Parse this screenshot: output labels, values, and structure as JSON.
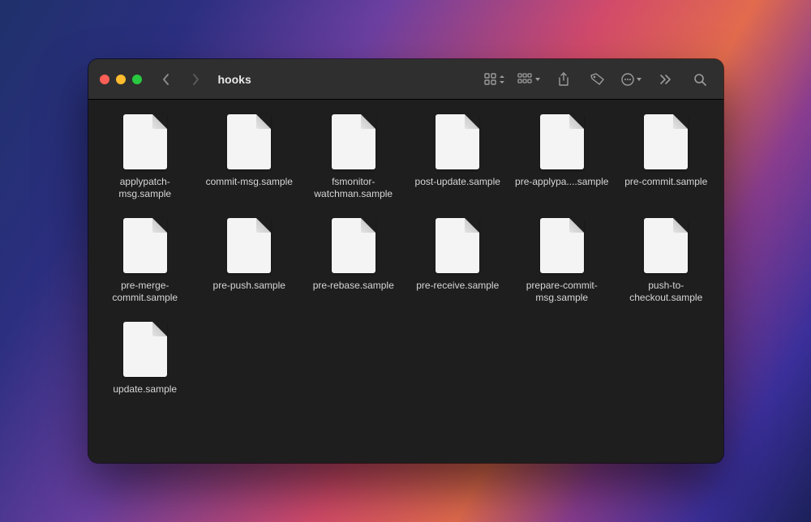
{
  "window": {
    "title": "hooks"
  },
  "files": [
    {
      "name": "applypatch-msg.sample"
    },
    {
      "name": "commit-msg.sample"
    },
    {
      "name": "fsmonitor-watchman.sample"
    },
    {
      "name": "post-update.sample"
    },
    {
      "name": "pre-applypa....sample"
    },
    {
      "name": "pre-commit.sample"
    },
    {
      "name": "pre-merge-commit.sample"
    },
    {
      "name": "pre-push.sample"
    },
    {
      "name": "pre-rebase.sample"
    },
    {
      "name": "pre-receive.sample"
    },
    {
      "name": "prepare-commit-msg.sample"
    },
    {
      "name": "push-to-checkout.sample"
    },
    {
      "name": "update.sample"
    }
  ]
}
